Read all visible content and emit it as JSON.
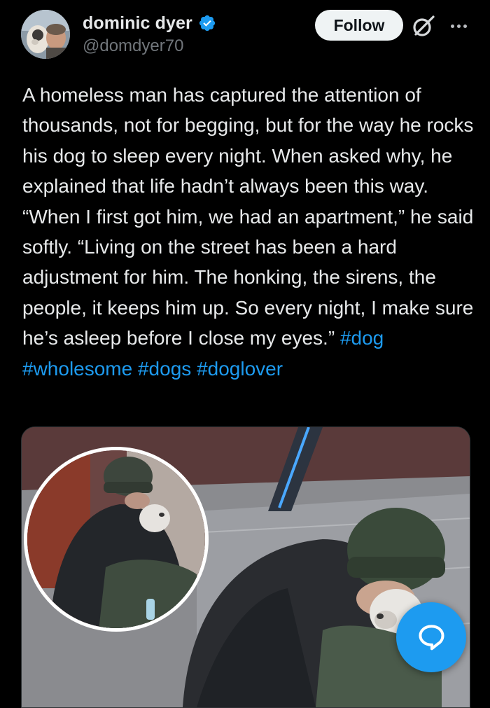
{
  "author": {
    "display_name": "dominic dyer",
    "handle": "@domdyer70",
    "verified": true,
    "avatar_icon": "profile-photo-with-dog"
  },
  "actions": {
    "follow_label": "Follow",
    "grok_icon": "grok-icon",
    "more_icon": "more-options-icon"
  },
  "tweet": {
    "text_segments": [
      "A homeless man has captured the attention of thousands, not for begging, but for the way he rocks his dog to sleep every night. When asked why, he explained that life hadn’t always been this way. “When I first got him, we had an apartment,” he said softly. “Living on the street has been a hard adjustment for him. The honking, the sirens, the people, it keeps him up. So every night, I make sure he’s asleep before I close my eyes.” "
    ],
    "hashtags": [
      "#dog",
      "#wholesome",
      "#dogs",
      "#doglover"
    ]
  },
  "media": {
    "description_icon": "photo-man-hugging-dog"
  },
  "fab": {
    "icon": "reply-bubble-icon"
  },
  "colors": {
    "background": "#000000",
    "text": "#e7e9ea",
    "secondary": "#71767b",
    "accent": "#1d9bf0",
    "follow_bg": "#eff3f4"
  }
}
